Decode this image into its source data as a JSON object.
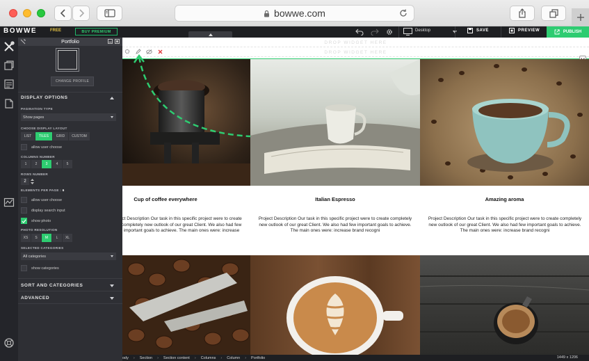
{
  "browser": {
    "url": "bowwe.com"
  },
  "editor": {
    "logo": "BOWWE",
    "plan_badge": "FREE",
    "premium_button": "BUY PREMIUM",
    "device_label": "Desktop",
    "save_label": "SAVE",
    "preview_label": "PREVIEW",
    "publish_label": "PUBLISH",
    "accent_color": "#2ecc71"
  },
  "panel": {
    "title": "Portfolio",
    "change_profile": "CHANGE PROFILE",
    "display_options": "DISPLAY OPTIONS",
    "pagination_type_label": "PAGINATION TYPE",
    "pagination_type_value": "Show pages",
    "layout_label": "CHOOSE DISPLAY LAYOUT",
    "layouts": [
      "LIST",
      "TILES",
      "GRID",
      "CUSTOM"
    ],
    "layout_selected": "TILES",
    "allow_user_choose_1": "allow user choose",
    "columns_label": "COLUMNS NUMBER",
    "columns": [
      "1",
      "2",
      "3",
      "4",
      "5"
    ],
    "columns_selected": "3",
    "rows_label": "ROWS NUMBER",
    "rows_value": "2",
    "elements_label": "ELEMENTS PER PAGE :",
    "elements_value": "6",
    "allow_user_choose_2": "allow user choose",
    "display_search": "display search input",
    "show_photo": "show photo",
    "photo_res_label": "PHOTO RESOLUTION",
    "resolutions": [
      "XS",
      "S",
      "M",
      "L",
      "XL"
    ],
    "resolution_selected": "M",
    "categories_label": "SELECTED CATEGORIES",
    "categories_value": "All categories",
    "show_categories": "show categories",
    "sort_section": "SORT AND CATEGORIES",
    "advanced_section": "ADVANCED"
  },
  "canvas": {
    "drop_widget": "DROP WIDGET HERE",
    "cards": [
      {
        "title": "Cup of coffee everywhere",
        "description": "Project Description Our task in this specific project were to create completely new outlook of our great Client. We also had few important goals to achieve. The main ones were: increase brand recogni"
      },
      {
        "title": "Italian Espresso",
        "description": "Project Description Our task in this specific project were to create completely new outlook of our great Client. We also had few important goals to achieve. The main ones were: increase brand recogni"
      },
      {
        "title": "Amazing aroma",
        "description": "Project Description Our task in this specific project were to create completely new outlook of our great Client. We also had few important goals to achieve. The main ones were: increase brand recogni"
      }
    ]
  },
  "statusbar": {
    "breadcrumb": [
      "ody",
      "Section",
      "Section content",
      "Columns",
      "Column",
      "Portfolio"
    ],
    "dimensions": "1449 x 1206"
  }
}
